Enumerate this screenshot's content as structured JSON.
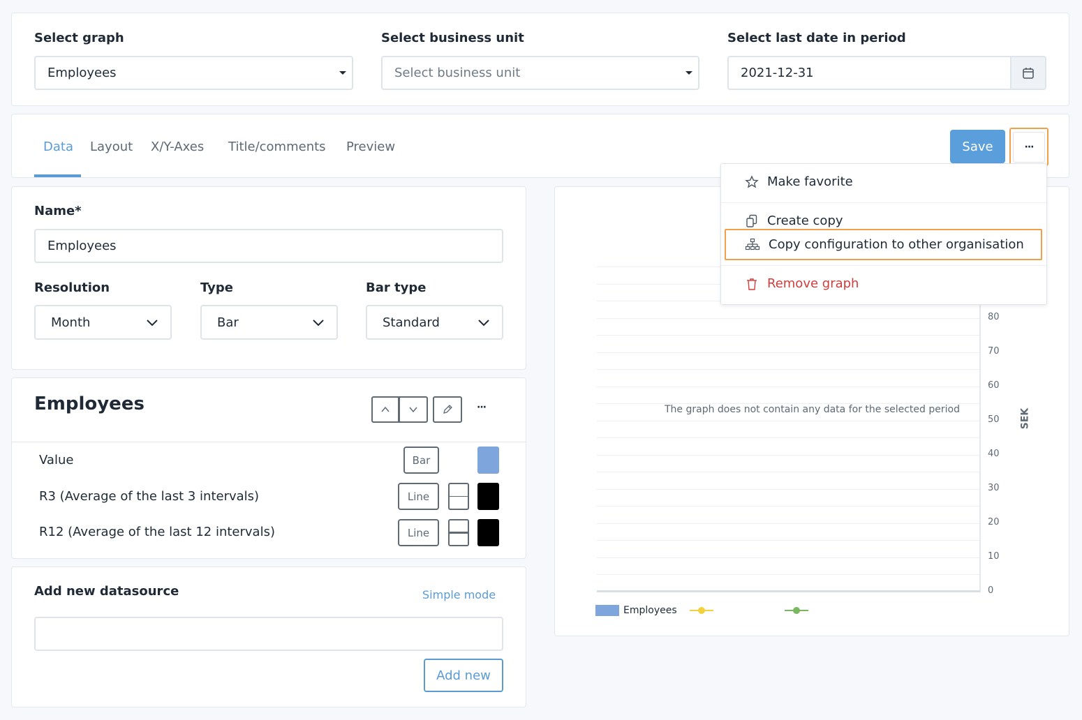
{
  "filters": {
    "graph_label": "Select graph",
    "graph_value": "Employees",
    "unit_label": "Select business unit",
    "unit_placeholder": "Select business unit",
    "date_label": "Select last date in period",
    "date_value": "2021-12-31"
  },
  "tabs": [
    {
      "label": "Data",
      "active": true
    },
    {
      "label": "Layout"
    },
    {
      "label": "X/Y-Axes"
    },
    {
      "label": "Title/comments"
    },
    {
      "label": "Preview"
    }
  ],
  "toolbar": {
    "save_label": "Save",
    "more_label": "···"
  },
  "menu": {
    "items": [
      {
        "label": "Make favorite",
        "icon": "star-icon"
      },
      {
        "label": "Create copy",
        "icon": "copy-icon"
      },
      {
        "label": "Copy configuration to other organisation",
        "icon": "org-chart-icon"
      },
      {
        "label": "Remove graph",
        "icon": "trash-icon",
        "color": "#d13c3c"
      }
    ]
  },
  "form": {
    "name_label": "Name*",
    "name_value": "Employees",
    "resolution_label": "Resolution",
    "resolution_value": "Month",
    "type_label": "Type",
    "type_value": "Bar",
    "bar_type_label": "Bar type",
    "bar_type_value": "Standard"
  },
  "series_card": {
    "title": "Employees",
    "more_label": "···",
    "rows": [
      {
        "label": "Value",
        "type": "Bar",
        "color": "#7ea6dc"
      },
      {
        "label": "R3 (Average of the last 3 intervals)",
        "type": "Line",
        "color": "#000000"
      },
      {
        "label": "R12 (Average of the last 12 intervals)",
        "type": "Line",
        "color": "#000000"
      }
    ]
  },
  "datasource": {
    "title": "Add new datasource",
    "mode_link": "Simple mode",
    "input_value": "",
    "add_label": "Add new"
  },
  "chart_data": {
    "type": "bar",
    "categories": [],
    "series": [],
    "empty_message": "The graph does not contain any data for the selected period",
    "ylabel": "SEK",
    "yticks": [
      80,
      70,
      60,
      50,
      40,
      30,
      20,
      10,
      0
    ],
    "ylim": [
      0,
      80
    ],
    "legend": [
      {
        "name": "Employees",
        "marker": "bar",
        "color": "#7ea6dc"
      },
      {
        "name": "",
        "marker": "line",
        "color": "#f2d23c"
      },
      {
        "name": "",
        "marker": "line",
        "color": "#7bb661"
      }
    ],
    "grid": true
  }
}
